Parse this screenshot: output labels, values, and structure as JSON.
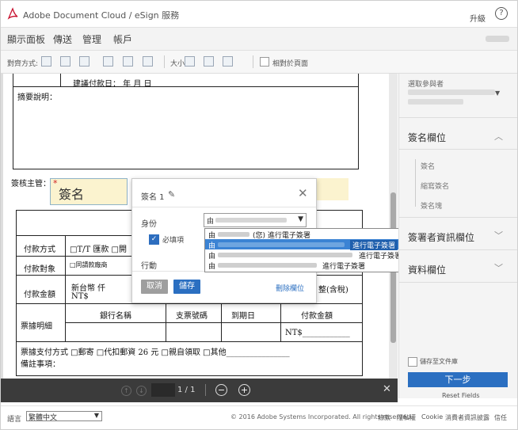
{
  "app": {
    "brand": "Adobe Document Cloud / eSign 服務",
    "upgrade": "升級",
    "help": "?"
  },
  "nav": {
    "items": [
      "顯示面板",
      "傳送",
      "管理",
      "帳戶"
    ]
  },
  "toolbar": {
    "align_label": "對齊方式:",
    "size_label": "大小",
    "relative_label": "相對於頁面"
  },
  "document": {
    "line_top": "建議付款日：     年     月     日",
    "summary": "摘要說明：",
    "signer_label": "簽核主管：",
    "signature_field": "簽名",
    "pay_method_label": "付款方式",
    "pay_method_value": "□T/T 匯款  □開",
    "pay_target_label": "付款對象",
    "pay_target_value": "□同請款廠商",
    "amount_label": "付款金額",
    "amount_ntd": "新台幣     仟",
    "amount_ntd2": "NT$",
    "amount_suffix": "整(含稅)",
    "bill_detail_label": "票據明細",
    "bank_col": "銀行名稱",
    "check_col": "支票號碼",
    "due_col": "到期日",
    "amount_col": "付款金額",
    "amount_cell": "NT$____________",
    "bill_pay_method": "票據支付方式 □郵寄  □代扣郵資 26 元   □親自領取   □其他________________",
    "remark": "備註事項："
  },
  "dialog": {
    "title": "簽名 1",
    "role_label": "身份",
    "role_prefix": "由",
    "required_label": "必填項",
    "action_label": "行動",
    "cancel": "取消",
    "save": "儲存",
    "delete": "刪除欄位"
  },
  "dropdown": {
    "options": [
      {
        "prefix": "由",
        "middle": "(您) 進行電子簽署",
        "action": ""
      },
      {
        "prefix": "由",
        "middle": "",
        "action": "進行電子簽署"
      },
      {
        "prefix": "由",
        "middle": "",
        "action": "進行電子簽署"
      },
      {
        "prefix": "由",
        "middle": "",
        "action": "進行電子簽署"
      }
    ]
  },
  "right_panel": {
    "participant_title": "選取參與者",
    "sections": [
      {
        "label": "簽名欄位",
        "expanded": true
      },
      {
        "label": "簽署者資訊欄位",
        "expanded": false
      },
      {
        "label": "資料欄位",
        "expanded": false
      }
    ],
    "sub_items": [
      "簽名",
      "縮寫簽名",
      "簽名塊"
    ],
    "store_label": "儲存至文件庫",
    "next": "下一步",
    "reset": "Reset Fields"
  },
  "viewer": {
    "page": "1 / 1"
  },
  "footer": {
    "lang_label": "語言",
    "lang_value": "繁體中文",
    "copyright": "© 2016 Adobe Systems Incorporated. All rights reserved.",
    "links": [
      "條款",
      "隱私權",
      "Cookie",
      "消費者資訊披露",
      "信任"
    ]
  },
  "colors": {
    "accent": "#2b6fc1",
    "field_bg": "#fbf3cf",
    "dark_bar": "#3b3b3b"
  }
}
